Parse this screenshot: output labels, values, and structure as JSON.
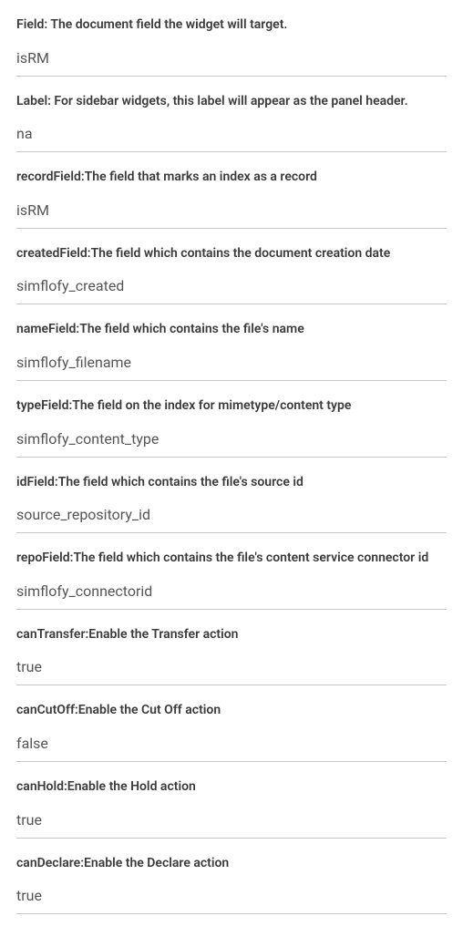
{
  "fields": [
    {
      "label": "Field: The document field the widget will target.",
      "value": "isRM",
      "name": "field"
    },
    {
      "label": "Label: For sidebar widgets, this label will appear as the panel header.",
      "value": "na",
      "name": "label"
    },
    {
      "label": "recordField:The field that marks an index as a record",
      "value": "isRM",
      "name": "record-field"
    },
    {
      "label": "createdField:The field which contains the document creation date",
      "value": "simflofy_created",
      "name": "created-field"
    },
    {
      "label": "nameField:The field which contains the file's name",
      "value": "simflofy_filename",
      "name": "name-field"
    },
    {
      "label": "typeField:The field on the index for mimetype/content type",
      "value": "simflofy_content_type",
      "name": "type-field"
    },
    {
      "label": "idField:The field which contains the file's source id",
      "value": "source_repository_id",
      "name": "id-field"
    },
    {
      "label": "repoField:The field which contains the file's content service connector id",
      "value": "simflofy_connectorid",
      "name": "repo-field"
    },
    {
      "label": "canTransfer:Enable the Transfer action",
      "value": "true",
      "name": "can-transfer"
    },
    {
      "label": "canCutOff:Enable the Cut Off action",
      "value": "false",
      "name": "can-cutoff"
    },
    {
      "label": "canHold:Enable the Hold action",
      "value": "true",
      "name": "can-hold"
    },
    {
      "label": "canDeclare:Enable the Declare action",
      "value": "true",
      "name": "can-declare"
    }
  ]
}
